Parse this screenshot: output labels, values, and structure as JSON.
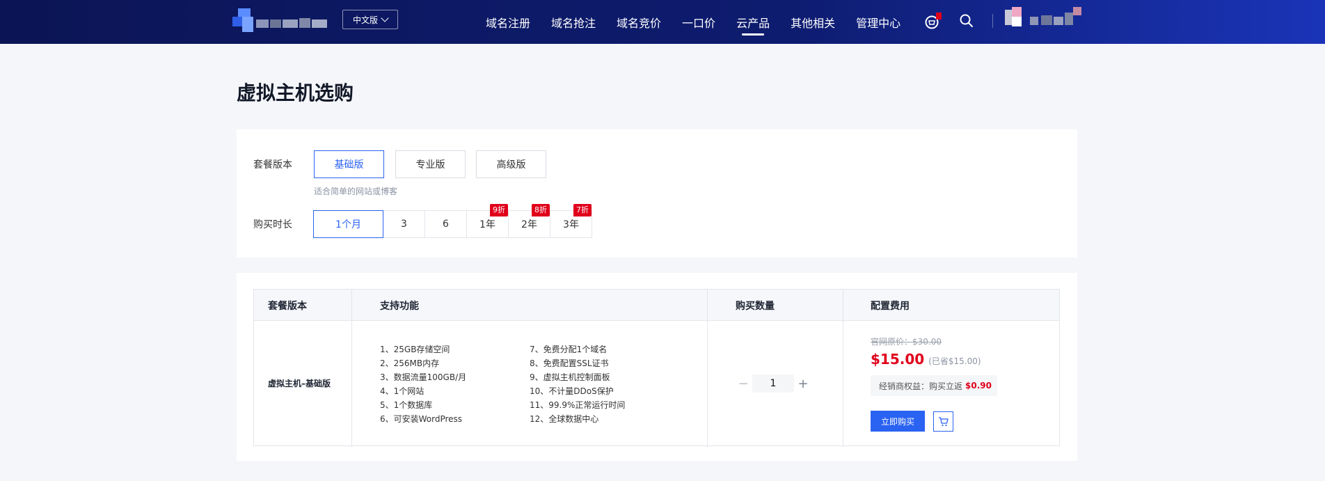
{
  "header": {
    "lang_label": "中文版",
    "nav": [
      {
        "label": "域名注册"
      },
      {
        "label": "域名抢注"
      },
      {
        "label": "域名竞价"
      },
      {
        "label": "一口价"
      },
      {
        "label": "云产品",
        "active": true
      },
      {
        "label": "其他相关"
      },
      {
        "label": "管理中心"
      }
    ]
  },
  "page": {
    "title": "虚拟主机选购"
  },
  "config": {
    "plan_label": "套餐版本",
    "plans": [
      "基础版",
      "专业版",
      "高级版"
    ],
    "selected_plan": "基础版",
    "plan_hint": "适合简单的网站或博客",
    "duration_label": "购买时长",
    "durations": [
      {
        "label": "1个月",
        "badge": ""
      },
      {
        "label": "3",
        "badge": ""
      },
      {
        "label": "6",
        "badge": ""
      },
      {
        "label": "1年",
        "badge": "9折"
      },
      {
        "label": "2年",
        "badge": "8折"
      },
      {
        "label": "3年",
        "badge": "7折"
      }
    ]
  },
  "table": {
    "headers": [
      "套餐版本",
      "支持功能",
      "购买数量",
      "配置费用"
    ],
    "product_name": "虚拟主机–基础版",
    "features_left": [
      "1、25GB存储空间",
      "2、256MB内存",
      "3、数据流量100GB/月",
      "4、1个网站",
      "5、1个数据库",
      "6、可安装WordPress"
    ],
    "features_right": [
      "7、免费分配1个域名",
      "8、免费配置SSL证书",
      "9、虚拟主机控制面板",
      "10、不计量DDoS保护",
      "11、99.9%正常运行时间",
      "12、全球数据中心"
    ],
    "quantity": "1",
    "price_original": "官网原价：$30.00",
    "price_now": "$15.00",
    "price_saved": "(已省$15.00)",
    "rebate_label": "经销商权益：购买立返",
    "rebate_amount": "$0.90",
    "buy_label": "立即购买"
  },
  "colors": {
    "accent": "#2a62f2",
    "price": "#e0001b",
    "header_start": "#0b1555",
    "header_end": "#1a34b8"
  }
}
